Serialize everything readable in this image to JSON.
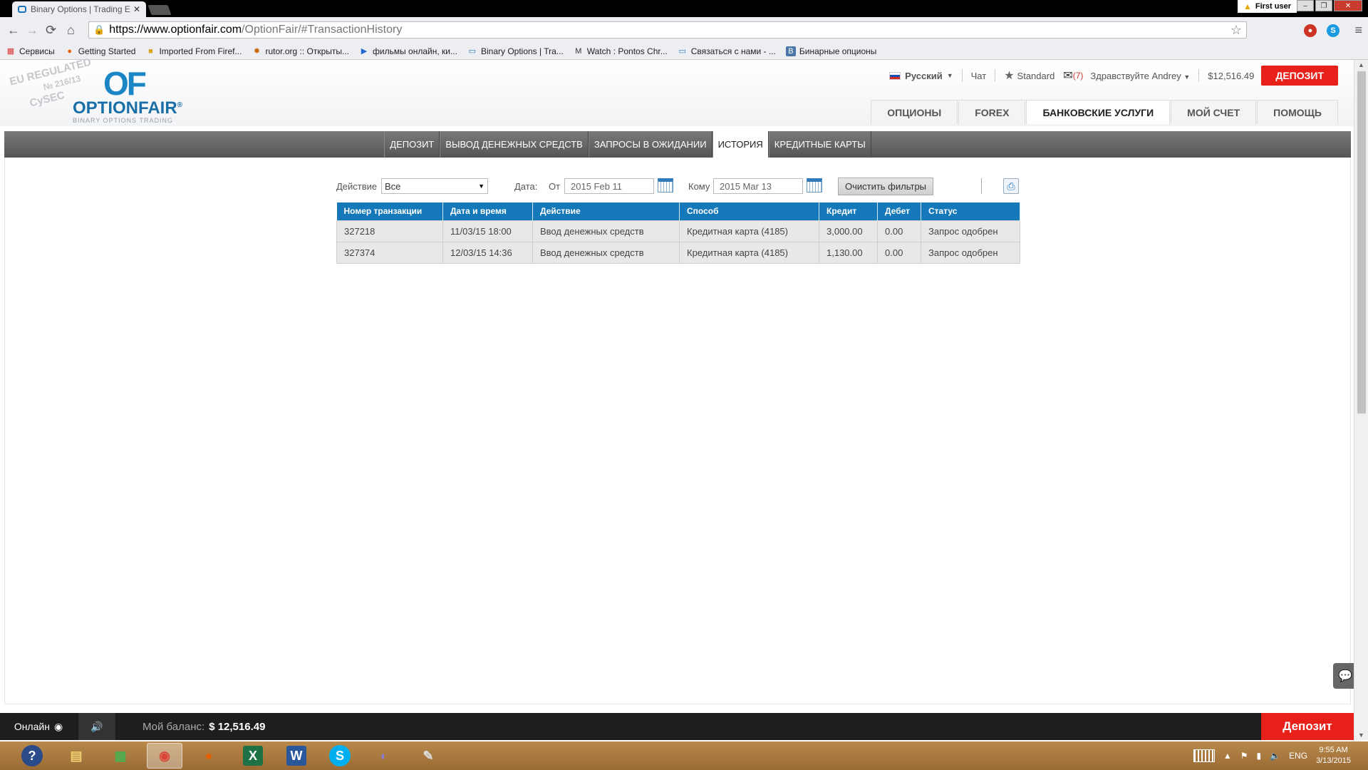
{
  "browser": {
    "tab_title": "Binary Options | Trading E",
    "user_badge": "First user",
    "url_host": "https://www.optionfair.com",
    "url_path": "/OptionFair/#TransactionHistory",
    "bookmarks": [
      {
        "label": "Сервисы",
        "icon": "apps-icon"
      },
      {
        "label": "Getting Started",
        "icon": "firefox-icon"
      },
      {
        "label": "Imported From Firef...",
        "icon": "folder-icon"
      },
      {
        "label": "rutor.org :: Открыты...",
        "icon": "rutor-icon"
      },
      {
        "label": "фильмы онлайн, ки...",
        "icon": "play-icon"
      },
      {
        "label": "Binary Options | Tra...",
        "icon": "optionfair-icon"
      },
      {
        "label": "Watch : Pontos Chr...",
        "icon": "mcdonalds-icon"
      },
      {
        "label": "Связаться с нами - ...",
        "icon": "optionfair-icon"
      },
      {
        "label": "Бинарные опционы",
        "icon": "vk-icon"
      }
    ]
  },
  "site": {
    "logo": {
      "stamp_line1": "EU REGULATED",
      "stamp_line2": "№ 216/13",
      "stamp_line3": "CySEC",
      "mark": "OF",
      "brand": "OPTIONFAIR",
      "registered": "®",
      "tagline": "BINARY OPTIONS TRADING"
    },
    "topbar": {
      "language": "Русский",
      "chat": "Чат",
      "account_type": "Standard",
      "mail_count": "(7)",
      "greeting": "Здравствуйте Andrey",
      "balance": "$12,516.49",
      "deposit": "ДЕПОЗИТ"
    },
    "main_nav": [
      {
        "label": "ОПЦИОНЫ",
        "active": false
      },
      {
        "label": "FOREX",
        "active": false
      },
      {
        "label": "БАНКОВСКИЕ УСЛУГИ",
        "active": true
      },
      {
        "label": "МОЙ СЧЕТ",
        "active": false
      },
      {
        "label": "ПОМОЩЬ",
        "active": false
      }
    ],
    "sub_nav": [
      {
        "label": "ДЕПОЗИТ",
        "active": false
      },
      {
        "label": "ВЫВОД ДЕНЕЖНЫХ СРЕДСТВ",
        "active": false
      },
      {
        "label": "ЗАПРОСЫ В ОЖИДАНИИ",
        "active": false
      },
      {
        "label": "ИСТОРИЯ",
        "active": true
      },
      {
        "label": "КРЕДИТНЫЕ КАРТЫ",
        "active": false
      }
    ],
    "filters": {
      "action_label": "Действие",
      "action_value": "Все",
      "date_label": "Дата:",
      "from_label": "От",
      "from_value": "2015 Feb 11",
      "to_label": "Кому",
      "to_value": "2015 Mar 13",
      "clear_button": "Очистить фильтры"
    },
    "table": {
      "headers": [
        "Номер транзакции",
        "Дата и время",
        "Действие",
        "Способ",
        "Кредит",
        "Дебет",
        "Статус"
      ],
      "rows": [
        [
          "327218",
          "11/03/15 18:00",
          "Ввод денежных средств",
          "Кредитная карта (4185)",
          "3,000.00",
          "0.00",
          "Запрос одобрен"
        ],
        [
          "327374",
          "12/03/15 14:36",
          "Ввод денежных средств",
          "Кредитная карта (4185)",
          "1,130.00",
          "0.00",
          "Запрос одобрен"
        ]
      ]
    },
    "statusbar": {
      "online": "Онлайн",
      "balance_label": "Мой баланс:",
      "balance_value": "$ 12,516.49",
      "deposit": "Депозит"
    }
  },
  "taskbar": {
    "apps": [
      "help-icon",
      "explorer-icon",
      "calculator-icon",
      "chrome-icon",
      "firefox-icon",
      "excel-icon",
      "word-icon",
      "skype-icon",
      "browser-icon",
      "paint-icon"
    ],
    "language": "ENG",
    "time": "9:55 AM",
    "date": "3/13/2015"
  },
  "colors": {
    "accent_blue": "#1578b8",
    "deposit_red": "#e8201a"
  }
}
